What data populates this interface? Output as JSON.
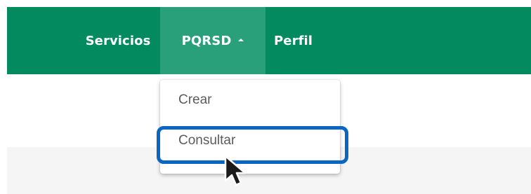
{
  "nav": {
    "items": [
      {
        "label": "Servicios"
      },
      {
        "label": "PQRSD"
      },
      {
        "label": "Perfil"
      }
    ]
  },
  "dropdown": {
    "items": [
      {
        "label": "Crear"
      },
      {
        "label": "Consultar"
      }
    ]
  },
  "colors": {
    "navbar": "#038a5f",
    "active_tab": "#2aa07a",
    "highlight": "#0a66c2"
  },
  "icons": {
    "caret": "caret-up-icon",
    "cursor": "mouse-pointer-icon"
  }
}
